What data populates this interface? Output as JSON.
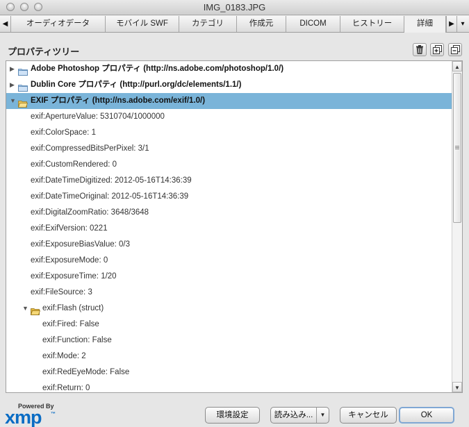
{
  "window": {
    "title": "IMG_0183.JPG"
  },
  "tabs": [
    {
      "label": "オーディオデータ"
    },
    {
      "label": "モバイル SWF"
    },
    {
      "label": "カテゴリ"
    },
    {
      "label": "作成元"
    },
    {
      "label": "DICOM"
    },
    {
      "label": "ヒストリー"
    },
    {
      "label": "詳細",
      "active": true
    }
  ],
  "panel": {
    "title": "プロパティツリー"
  },
  "tree": {
    "nodes": [
      {
        "label": "Adobe Photoshop プロパティ (http://ns.adobe.com/photoshop/1.0/)",
        "level": 0,
        "expanded": false,
        "bold": true
      },
      {
        "label": "Dublin Core プロパティ (http://purl.org/dc/elements/1.1/)",
        "level": 0,
        "expanded": false,
        "bold": true
      },
      {
        "label": "EXIF プロパティ (http://ns.adobe.com/exif/1.0/)",
        "level": 0,
        "expanded": true,
        "bold": true,
        "selected": true
      },
      {
        "label": "exif:ApertureValue: 5310704/1000000",
        "level": 1
      },
      {
        "label": "exif:ColorSpace: 1",
        "level": 1
      },
      {
        "label": "exif:CompressedBitsPerPixel: 3/1",
        "level": 1
      },
      {
        "label": "exif:CustomRendered: 0",
        "level": 1
      },
      {
        "label": "exif:DateTimeDigitized: 2012-05-16T14:36:39",
        "level": 1
      },
      {
        "label": "exif:DateTimeOriginal: 2012-05-16T14:36:39",
        "level": 1
      },
      {
        "label": "exif:DigitalZoomRatio: 3648/3648",
        "level": 1
      },
      {
        "label": "exif:ExifVersion: 0221",
        "level": 1
      },
      {
        "label": "exif:ExposureBiasValue: 0/3",
        "level": 1
      },
      {
        "label": "exif:ExposureMode: 0",
        "level": 1
      },
      {
        "label": "exif:ExposureTime: 1/20",
        "level": 1
      },
      {
        "label": "exif:FileSource: 3",
        "level": 1
      },
      {
        "label": "exif:Flash (struct)",
        "level": 1,
        "expanded": true,
        "folder": true
      },
      {
        "label": "exif:Fired: False",
        "level": 2
      },
      {
        "label": "exif:Function: False",
        "level": 2
      },
      {
        "label": "exif:Mode: 2",
        "level": 2
      },
      {
        "label": "exif:RedEyeMode: False",
        "level": 2
      },
      {
        "label": "exif:Return: 0",
        "level": 2
      }
    ]
  },
  "footer": {
    "powered_by": "Powered By",
    "logo_word": "xmp",
    "settings_button": "環境設定",
    "import_button": "読み込み...",
    "cancel_button": "キャンセル",
    "ok_button": "OK"
  },
  "icons": {
    "trash": "trash-icon",
    "expand_all": "expand-all-icon",
    "collapse_all": "collapse-all-icon",
    "folder": "folder-icon"
  },
  "colors": {
    "selection": "#7ab4d9",
    "xmp_blue": "#0a6cc4"
  }
}
